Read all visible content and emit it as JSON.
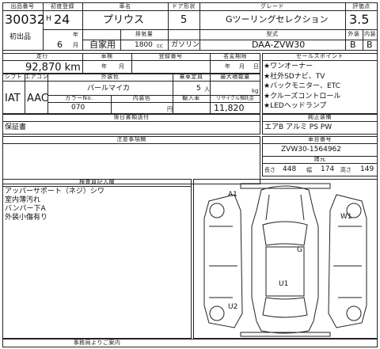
{
  "header_row": {
    "labels": {
      "lot": "出品番号",
      "year": "初度登録",
      "car_name": "車名",
      "doors": "ドア形状",
      "grade": "グレード",
      "score": "評価点"
    },
    "lot_number": "30032",
    "lot_tag": "初出品",
    "era": "H",
    "year_value": "24",
    "year_unit": "年",
    "month_value": "6",
    "month_unit": "月",
    "car_name": "プリウス",
    "doors": "5",
    "grade": "Gツーリングセレクション",
    "score": "3.5",
    "usage": "自家用",
    "displacement_label": "排気量",
    "displacement": "1800",
    "displacement_unit": "cc",
    "fuel": "ガソリン",
    "model_label": "型式",
    "model": "DAA-ZVW30",
    "exterior_label": "外装",
    "interior_label": "内装",
    "exterior_grade": "B",
    "interior_grade": "B"
  },
  "mileage_row": {
    "labels": {
      "mileage": "走行",
      "inspection": "車検",
      "reg_number": "登録番号",
      "name_change": "名変期限"
    },
    "mileage": "92,870 km",
    "inspection_year_unit": "年",
    "inspection_month_unit": "月",
    "year_unit": "年",
    "month_unit": "月",
    "day_unit": "日"
  },
  "spec_row": {
    "labels": {
      "shift": "シフト",
      "ac": "エアコン",
      "exterior_color": "外装色",
      "capacity": "乗車定員",
      "max_load": "最大積載量",
      "color_no": "カラーNo.",
      "interior_color": "内装色",
      "import": "輸入車",
      "recycle": "リサイクル預託金"
    },
    "shift": "IAT",
    "ac": "AAC",
    "exterior_color": "パールマイカ",
    "capacity": "5",
    "capacity_unit": "人",
    "load_unit": "kg",
    "color_no": "070",
    "recycle": "11,820",
    "recycle_unit": "円"
  },
  "docs": {
    "label": "後日書類送付",
    "value": "保証書"
  },
  "notes": {
    "label": "注意事項欄"
  },
  "sales_points": {
    "label": "セールスポイント",
    "items": [
      "★ワンオーナー",
      "★社外SDナビ、TV",
      "★バックモニター、ETC",
      "★クルーズコントロール",
      "★LEDヘッドランプ"
    ]
  },
  "equipment": {
    "label": "純正装備",
    "value": "エアB アルミ PS PW"
  },
  "chassis": {
    "label": "車台番号",
    "value": "ZVW30-1564962"
  },
  "dimensions": {
    "label": "諸元",
    "length_label": "長さ",
    "length": "448",
    "width_label": "幅",
    "width": "174",
    "height_label": "高さ",
    "height": "149"
  },
  "inspector": {
    "label": "検査員記入欄",
    "lines": [
      "アッパーサポート（ネジ）シワ",
      "室内薄汚れ",
      "バンパー下A",
      "外装小傷有り"
    ]
  },
  "diagram": {
    "marks": [
      "A1",
      "W1",
      "G",
      "U1",
      "U2"
    ]
  },
  "footer": {
    "label": "事務局よりご案内"
  }
}
